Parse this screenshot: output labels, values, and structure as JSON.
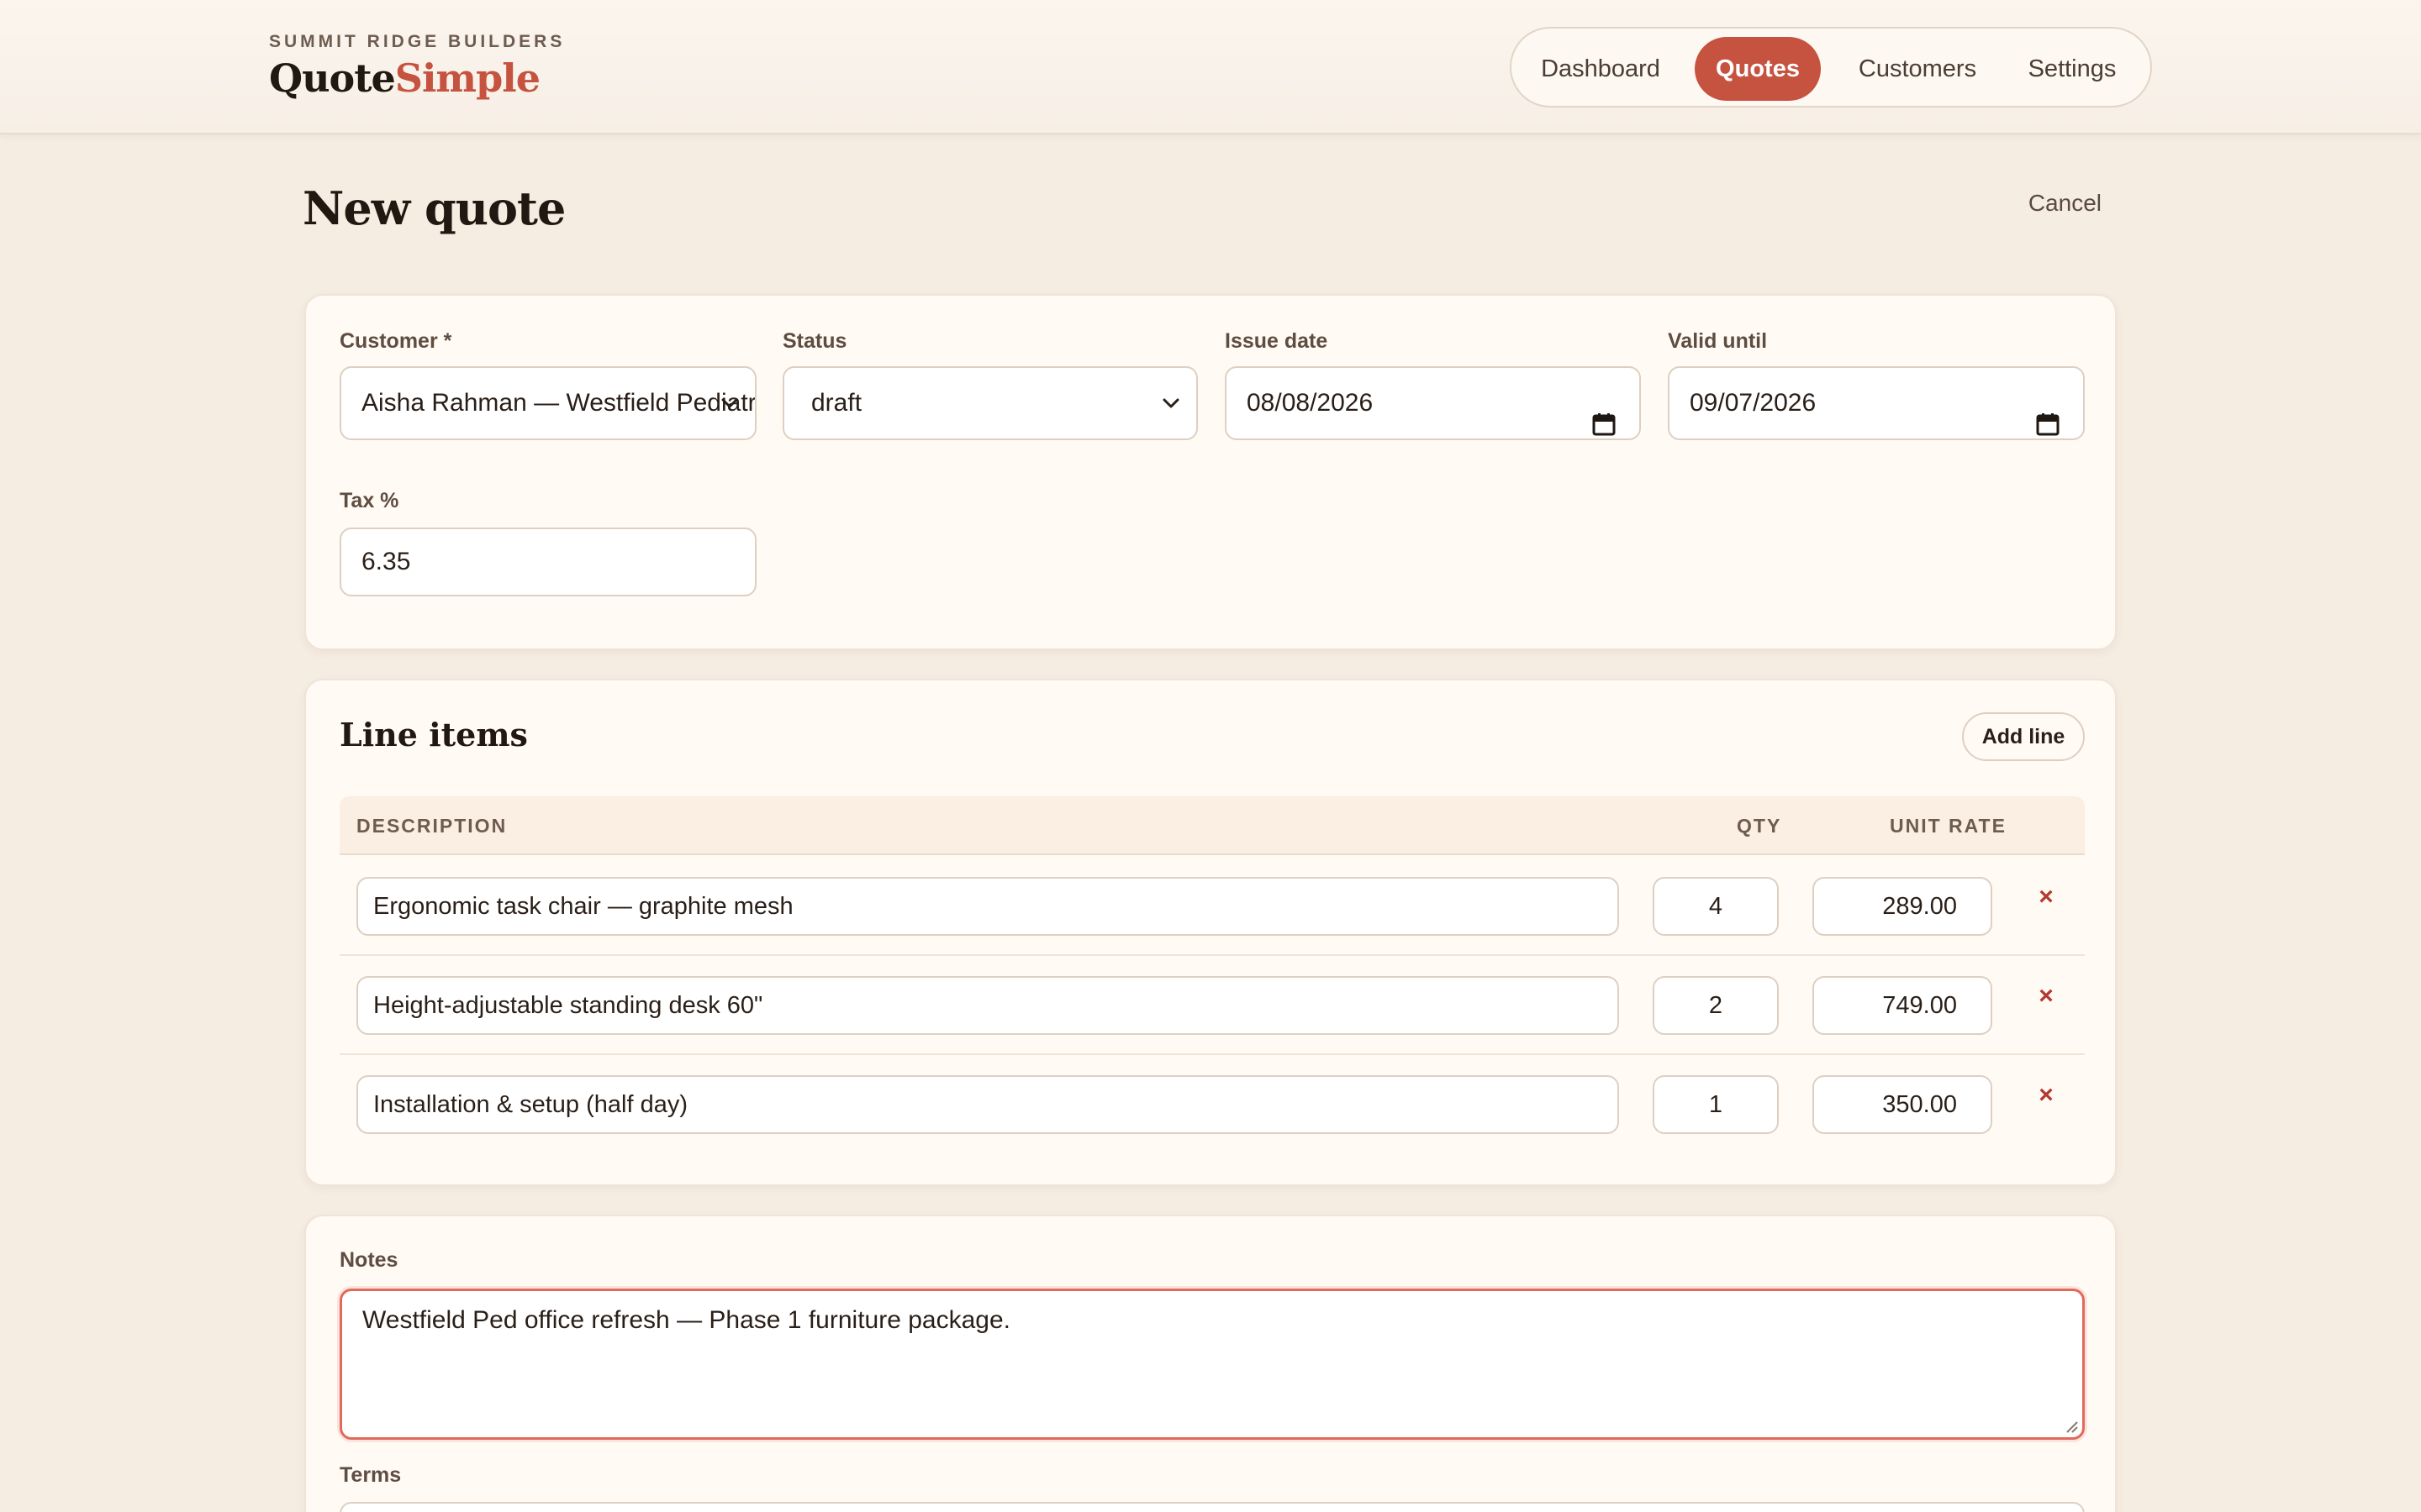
{
  "brand": {
    "kicker": "SUMMIT RIDGE BUILDERS",
    "logo_part1": "Quote",
    "logo_part2": "Simple",
    "accent_color": "#c5533f"
  },
  "nav": {
    "items": [
      {
        "label": "Dashboard",
        "active": false
      },
      {
        "label": "Quotes",
        "active": true
      },
      {
        "label": "Customers",
        "active": false
      },
      {
        "label": "Settings",
        "active": false
      }
    ]
  },
  "page": {
    "title": "New quote",
    "cancel_label": "Cancel"
  },
  "details": {
    "customer": {
      "label": "Customer *",
      "value": "Aisha Rahman — Westfield Pediatrics"
    },
    "status": {
      "label": "Status",
      "value": "draft"
    },
    "issue_date": {
      "label": "Issue date",
      "value": "08/08/2026"
    },
    "valid_until": {
      "label": "Valid until",
      "value": "09/07/2026"
    },
    "tax": {
      "label": "Tax %",
      "value": "6.35"
    }
  },
  "line_items": {
    "title": "Line items",
    "add_label": "Add line",
    "columns": [
      "DESCRIPTION",
      "QTY",
      "UNIT RATE"
    ],
    "rows": [
      {
        "description": "Ergonomic task chair — graphite mesh",
        "qty": "4",
        "rate": "289.00"
      },
      {
        "description": "Height-adjustable standing desk 60\"",
        "qty": "2",
        "rate": "749.00"
      },
      {
        "description": "Installation & setup (half day)",
        "qty": "1",
        "rate": "350.00"
      }
    ],
    "remove_glyph": "×"
  },
  "notes": {
    "label": "Notes",
    "value": "Westfield Ped office refresh — Phase 1 furniture package."
  },
  "terms": {
    "label": "Terms"
  },
  "icons": {
    "chevron": "chevron-down-icon",
    "calendar": "calendar-icon",
    "remove": "close-icon"
  }
}
